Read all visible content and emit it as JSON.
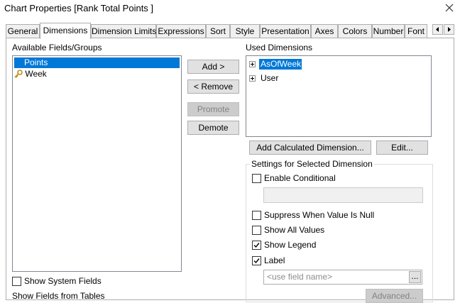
{
  "window": {
    "title": "Chart Properties [Rank Total Points ]"
  },
  "tabs": [
    {
      "label": "General"
    },
    {
      "label": "Dimensions"
    },
    {
      "label": "Dimension Limits"
    },
    {
      "label": "Expressions"
    },
    {
      "label": "Sort"
    },
    {
      "label": "Style"
    },
    {
      "label": "Presentation"
    },
    {
      "label": "Axes"
    },
    {
      "label": "Colors"
    },
    {
      "label": "Number"
    },
    {
      "label": "Font"
    }
  ],
  "available": {
    "label": "Available Fields/Groups",
    "items": [
      {
        "label": "Points",
        "selected": true
      },
      {
        "label": "Week",
        "icon": "key-icon"
      }
    ],
    "show_system_fields": "Show System Fields",
    "show_fields_from_tables": "Show Fields from Tables"
  },
  "buttons": {
    "add": "Add >",
    "remove": "< Remove",
    "promote": "Promote",
    "demote": "Demote",
    "add_calculated": "Add Calculated Dimension...",
    "edit": "Edit...",
    "browse": "...",
    "advanced": "Advanced..."
  },
  "used": {
    "label": "Used Dimensions",
    "items": [
      {
        "label": "AsOfWeek",
        "selected": true
      },
      {
        "label": "User"
      }
    ]
  },
  "settings": {
    "title": "Settings for Selected Dimension",
    "enable_conditional": "Enable Conditional",
    "suppress_null": "Suppress When Value Is Null",
    "show_all_values": "Show All Values",
    "show_legend": "Show Legend",
    "label": "Label",
    "label_placeholder": "<use field name>"
  },
  "colors": {
    "selection": "#0078d7",
    "border": "#adadad"
  }
}
